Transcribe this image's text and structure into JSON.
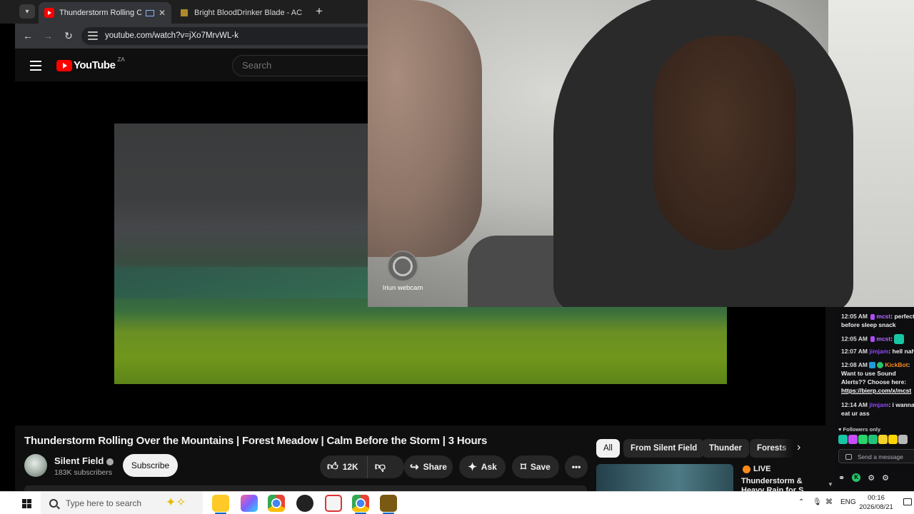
{
  "browser": {
    "tabs": [
      {
        "title": "Thunderstorm Rolling Over",
        "active": true
      },
      {
        "title": "Bright BloodDrinker Blade - AC",
        "active": false
      }
    ],
    "new_tab_symbol": "+",
    "url": "youtube.com/watch?v=jXo7MrvWL-k"
  },
  "youtube": {
    "logo_text": "YouTube",
    "country_code": "ZA",
    "search_placeholder": "Search"
  },
  "webcam": {
    "label": "Iriun webcam"
  },
  "video": {
    "title": "Thunderstorm Rolling Over the Mountains | Forest Meadow | Calm Before the Storm | 3 Hours",
    "channel": "Silent Field",
    "subscribers": "183K subscribers",
    "subscribe_label": "Subscribe",
    "like_count": "12K",
    "share_label": "Share",
    "ask_label": "Ask",
    "save_label": "Save"
  },
  "chips": [
    "All",
    "From Silent Field",
    "Thunder",
    "Forests"
  ],
  "related": {
    "live_label": "LIVE",
    "title": "Thunderstorm & Heavy Rain for S"
  },
  "chat": {
    "messages": [
      {
        "time": "12:05 AM",
        "user": "mcst",
        "text": "perfect before sleep snack"
      },
      {
        "time": "12:05 AM",
        "user": "mcst",
        "text": ""
      },
      {
        "time": "12:07 AM",
        "user": "jimjam",
        "text": "hell nah"
      },
      {
        "time": "12:08 AM",
        "user": "KickBot",
        "text": "Want to use Sound Alerts?? Choose here:",
        "link": "https://bierp.com/x/mcst"
      },
      {
        "time": "12:14 AM",
        "user": "jimjam",
        "text": "i wanna eat ur ass"
      }
    ],
    "followers_only": "Followers only",
    "send_placeholder": "Send a message"
  },
  "taskbar": {
    "search_placeholder": "Type here to search",
    "language": "ENG",
    "time": "00:16",
    "date": "2026/08/21"
  },
  "colors": {
    "youtube_red": "#ff0000",
    "chat_username_purple": "#b56cff",
    "kickbot_orange": "#ff8a1a",
    "live_badge": "#ff8a1a"
  }
}
